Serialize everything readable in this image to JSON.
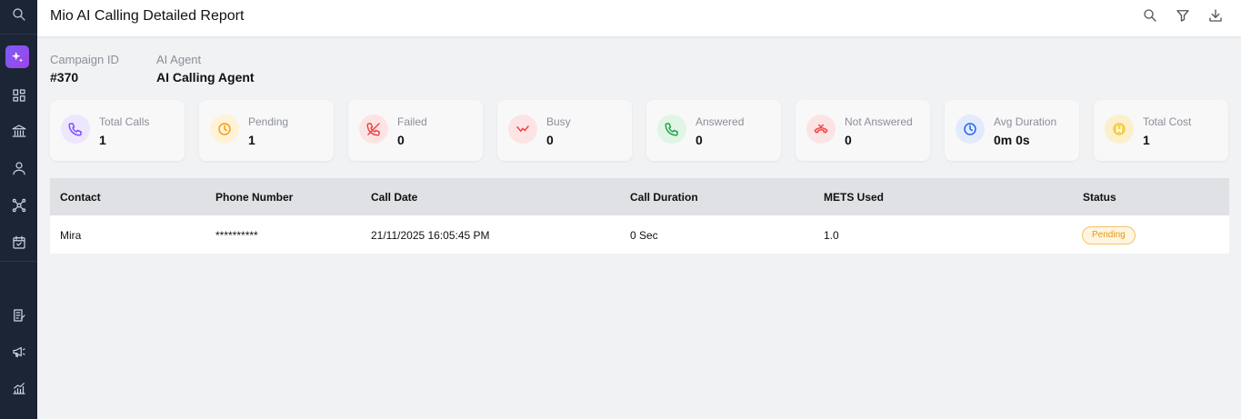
{
  "header": {
    "title": "Mio AI Calling Detailed Report"
  },
  "icons": {
    "header": [
      "search-icon",
      "filter-icon",
      "download-icon"
    ],
    "sidebar": [
      "search-icon",
      "ai-sparkle-icon",
      "dashboard-icon",
      "bank-icon",
      "user-icon",
      "network-icon",
      "calendar-check-icon",
      "notes-icon",
      "megaphone-icon",
      "analytics-icon"
    ]
  },
  "info": {
    "campaign_label": "Campaign ID",
    "campaign_value": "#370",
    "agent_label": "AI Agent",
    "agent_value": "AI Calling Agent"
  },
  "stats": [
    {
      "label": "Total Calls",
      "value": "1",
      "icon": "phone-icon",
      "color": "#7c4dff"
    },
    {
      "label": "Pending",
      "value": "1",
      "icon": "clock-icon",
      "color": "#f59e0b"
    },
    {
      "label": "Failed",
      "value": "0",
      "icon": "phone-missed-icon",
      "color": "#ef4444"
    },
    {
      "label": "Busy",
      "value": "0",
      "icon": "busy-icon",
      "color": "#ef4444"
    },
    {
      "label": "Answered",
      "value": "0",
      "icon": "phone-answered-icon",
      "color": "#22a447"
    },
    {
      "label": "Not Answered",
      "value": "0",
      "icon": "phone-hangup-icon",
      "color": "#ef4444"
    },
    {
      "label": "Avg Duration",
      "value": "0m 0s",
      "icon": "clock-icon",
      "color": "#2563eb"
    },
    {
      "label": "Total Cost",
      "value": "1",
      "icon": "coin-icon",
      "color": "#f2c94c"
    }
  ],
  "table": {
    "columns": [
      "Contact",
      "Phone Number",
      "Call Date",
      "Call Duration",
      "METS Used",
      "Status"
    ],
    "rows": [
      [
        "Mira",
        "**********",
        "21/11/2025 16:05:45 PM",
        "0 Sec",
        "1.0",
        "Pending"
      ]
    ]
  }
}
